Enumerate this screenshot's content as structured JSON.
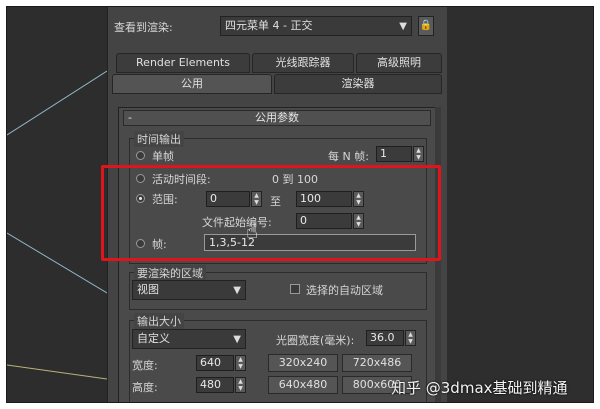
{
  "view_to_render": {
    "label": "查看到渲染:",
    "value": "四元菜单 4 - 正交"
  },
  "tabs_row1": [
    "Render Elements",
    "光线跟踪器",
    "高级照明"
  ],
  "tabs_row2": [
    "公用",
    "渲染器"
  ],
  "rollout": {
    "collapse_symbol": "-",
    "title": "公用参数"
  },
  "time_output": {
    "title": "时间输出",
    "single": "单帧",
    "every_n_label": "每 N 帧:",
    "every_n_value": "1",
    "active_segment": "活动时间段:",
    "active_range": "0 到 100",
    "range": "范围:",
    "range_from": "0",
    "range_to_label": "至",
    "range_to": "100",
    "file_start_label": "文件起始编号:",
    "file_start_value": "0",
    "frames": "帧:",
    "frames_value": "1,3,5-12"
  },
  "area": {
    "title": "要渲染的区域",
    "value": "视图",
    "auto_region": "选择的自动区域"
  },
  "output_size": {
    "title": "输出大小",
    "preset": "自定义",
    "aperture_label": "光圈宽度(毫米):",
    "aperture_value": "36.0",
    "width_label": "宽度:",
    "width_value": "640",
    "height_label": "高度:",
    "height_value": "480",
    "presets": [
      "320x240",
      "720x486",
      "640x480",
      "800x600"
    ]
  },
  "watermark": "知乎 @3dmax基础到精通",
  "colors": {
    "highlight": "#e0151c",
    "panel": "#444444"
  }
}
